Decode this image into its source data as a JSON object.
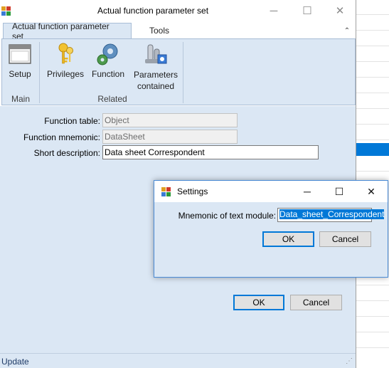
{
  "window": {
    "title": "Actual function parameter set"
  },
  "ribbon": {
    "tabs": [
      {
        "label": "Actual function parameter set"
      },
      {
        "label": "Tools"
      }
    ],
    "buttons": [
      {
        "label": "Setup",
        "icon": "window-icon"
      },
      {
        "label": "Privileges",
        "icon": "keys-icon"
      },
      {
        "label": "Function",
        "icon": "gears-icon"
      },
      {
        "label": "Parameters\ncontained",
        "icon": "parameters-icon"
      }
    ],
    "groups": [
      {
        "label": "Main"
      },
      {
        "label": "Related"
      }
    ]
  },
  "form": {
    "function_table": {
      "label": "Function table:",
      "value": "Object"
    },
    "function_mnemonic": {
      "label": "Function mnemonic:",
      "value": "DataSheet"
    },
    "short_description": {
      "label": "Short description:",
      "value": "Data sheet Correspondent"
    },
    "ok_label": "OK",
    "cancel_label": "Cancel"
  },
  "status": {
    "text": "Update"
  },
  "dialog": {
    "title": "Settings",
    "mnemonic_label": "Mnemonic of text module:",
    "mnemonic_value": "Data_sheet_Correspondent",
    "ok_label": "OK",
    "cancel_label": "Cancel"
  },
  "colors": {
    "ribbon_bg": "#dbe7f4",
    "accent": "#0078d7"
  }
}
